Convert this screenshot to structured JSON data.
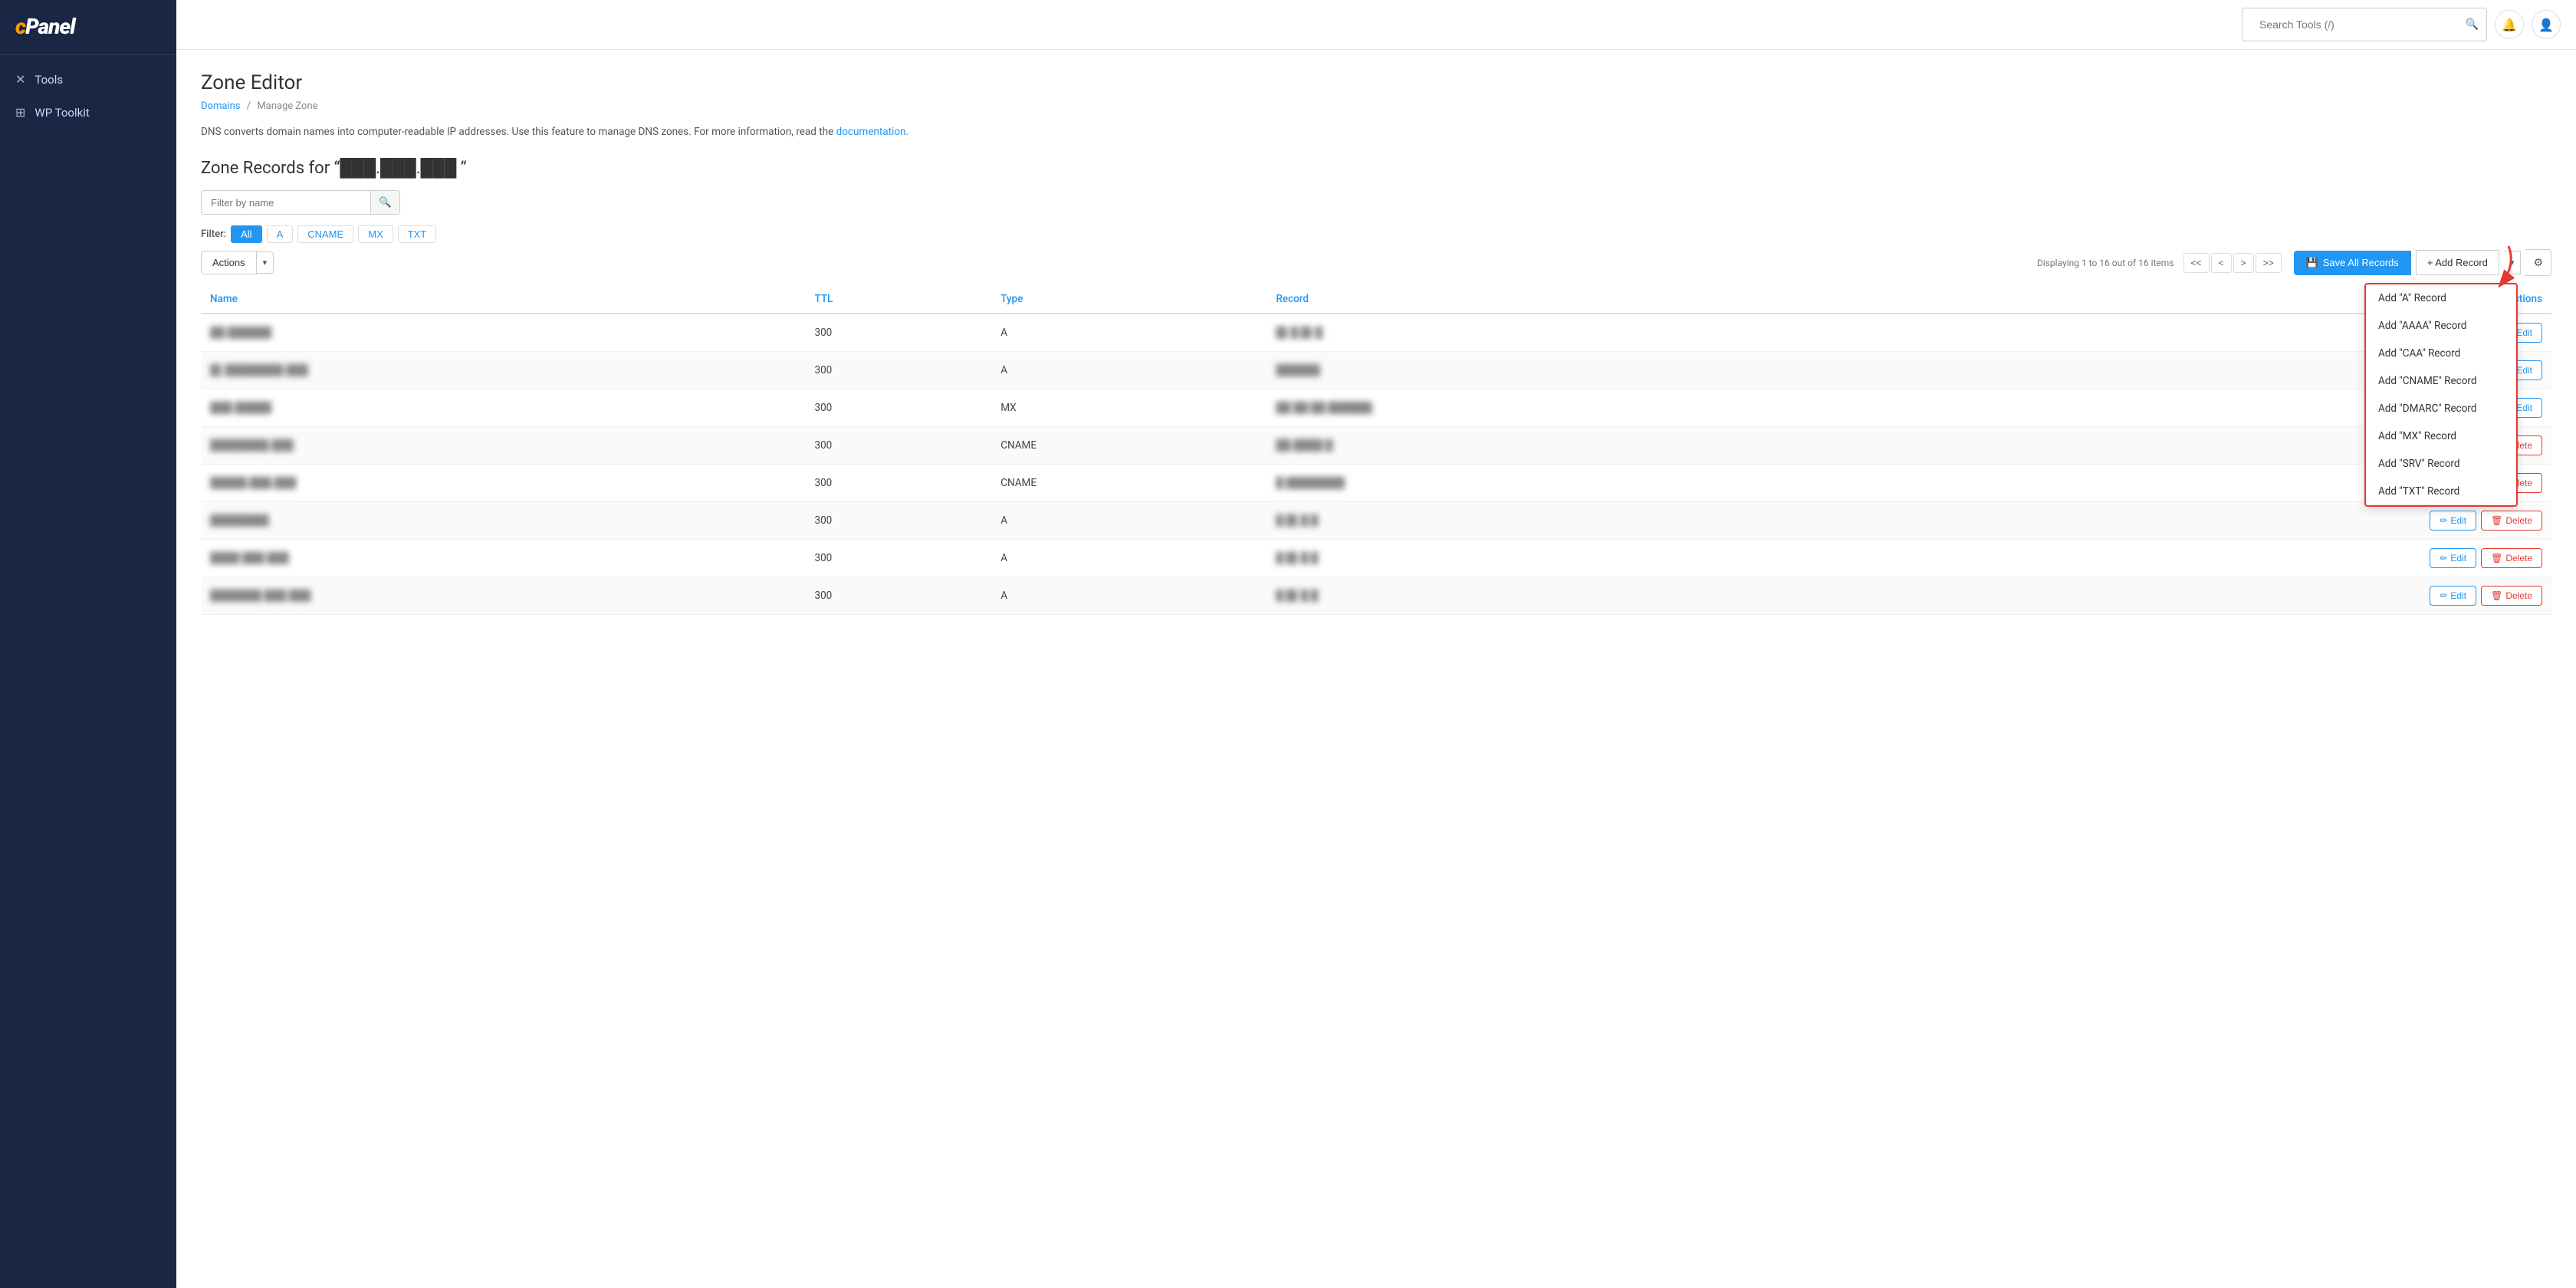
{
  "sidebar": {
    "logo": "cPanel",
    "items": [
      {
        "id": "tools",
        "label": "Tools",
        "icon": "✕"
      },
      {
        "id": "wp-toolkit",
        "label": "WP Toolkit",
        "icon": "⊞"
      }
    ]
  },
  "topbar": {
    "search_placeholder": "Search Tools (/)",
    "search_value": ""
  },
  "page": {
    "title": "Zone Editor",
    "breadcrumb_link": "Domains",
    "breadcrumb_current": "Manage Zone",
    "description": "DNS converts domain names into computer-readable IP addresses. Use this feature to manage DNS zones. For more information, read the",
    "description_link": "documentation",
    "zone_records_title": "Zone Records for “███.███.███ ”",
    "filter_placeholder": "Filter by name",
    "filter_label": "Filter:",
    "filter_types": [
      "All",
      "A",
      "CNAME",
      "MX",
      "TXT"
    ],
    "filter_active": "All",
    "actions_label": "Actions",
    "pagination": {
      "first": "<<",
      "prev": "<",
      "next": ">",
      "last": ">>",
      "info": "Displaying 1 to 16 out of 16 items"
    },
    "save_all_label": "Save All Records",
    "add_record_label": "+ Add Record",
    "dropdown_items": [
      "Add \"A\" Record",
      "Add \"AAAA\" Record",
      "Add \"CAA\" Record",
      "Add \"CNAME\" Record",
      "Add \"DMARC\" Record",
      "Add \"MX\" Record",
      "Add \"SRV\" Record",
      "Add \"TXT\" Record"
    ],
    "table_headers": [
      "Name",
      "TTL",
      "Type",
      "Record",
      "Actions"
    ],
    "records": [
      {
        "name": "██.██████",
        "ttl": "300",
        "type": "A",
        "record": "█▌█ █▌█",
        "edit": true,
        "delete": false
      },
      {
        "name": "█▌████████.███",
        "ttl": "300",
        "type": "A",
        "record": "██████",
        "edit": true,
        "delete": false
      },
      {
        "name": "███.█████",
        "ttl": "300",
        "type": "MX",
        "record": "██.██ ██.██████. .",
        "edit": true,
        "delete": false
      },
      {
        "name": "████████.███",
        "ttl": "300",
        "type": "CNAME",
        "record": "██.████.█",
        "edit": true,
        "delete": true
      },
      {
        "name": "█████.███.███",
        "ttl": "300",
        "type": "CNAME",
        "record": "█.████████",
        "edit": true,
        "delete": true
      },
      {
        "name": "████████.",
        "ttl": "300",
        "type": "A",
        "record": "█.█▌█.█",
        "edit": true,
        "delete": true
      },
      {
        "name": "████.███.███",
        "ttl": "300",
        "type": "A",
        "record": "█.█▌█.█",
        "edit": true,
        "delete": true
      },
      {
        "name": "███████.███.███",
        "ttl": "300",
        "type": "A",
        "record": "█.█▌█.█",
        "edit": true,
        "delete": true
      }
    ],
    "edit_label": "Edit",
    "delete_label": "Delete"
  }
}
